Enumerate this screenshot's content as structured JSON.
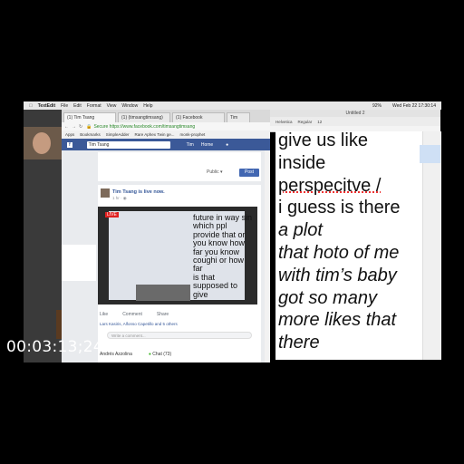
{
  "menubar": {
    "app": "TextEdit",
    "items": [
      "File",
      "Edit",
      "Format",
      "View",
      "Window",
      "Help"
    ],
    "clock": "Wed Feb 22  17:30:14",
    "battery": "92%"
  },
  "browser": {
    "tabs": [
      "(1) Tim Tsang",
      "(1) (timsangtimsang)",
      "(1) Facebook",
      "Tim"
    ],
    "url": "Secure  https://www.facebook.com/timsangtimsang",
    "bookmarks": [
      "Apps",
      "Bookmarks",
      "SimpleAdder",
      "Rare Aphex Twin ge...",
      "monk-prophet"
    ],
    "fb_search": "Tim Tsang",
    "fb_nav": [
      "Tim",
      "Home"
    ],
    "public_label": "Public ▾",
    "post_button": "Post",
    "poster_name": "Tim Tsang is live now.",
    "poster_time": "1 hr · ◉",
    "live_badge": "LIVE",
    "video_text": "future in way sin\nwhich ppl\nprovide that or\nyou know how\nfar you know\ncoughi or how\nfar\nis that\nsupposed to\ngive",
    "actions": [
      "Like",
      "Comment",
      "Share"
    ],
    "likes_line": "Lars Kasiris, Alfonso Capetillo and 5 others",
    "comment_placeholder": "Write a comment...",
    "chat_name": "Andrés Azzolina",
    "chat_label": "Chat (73)"
  },
  "textedit": {
    "title": "Untitled 2",
    "toolbar": [
      "Helvetica",
      "Regular",
      "12"
    ],
    "lines": [
      "give us like",
      "inside",
      "perspecitve /",
      "i guess is there",
      "a plot",
      "that hoto of me",
      "with tim’s baby",
      "got so many",
      "more likes that",
      "there"
    ]
  },
  "overlay": {
    "timecode": "00:03:13;24"
  },
  "colors": {
    "facebook_blue": "#3b5998",
    "live_red": "#e02020",
    "link_blue": "#365899"
  }
}
